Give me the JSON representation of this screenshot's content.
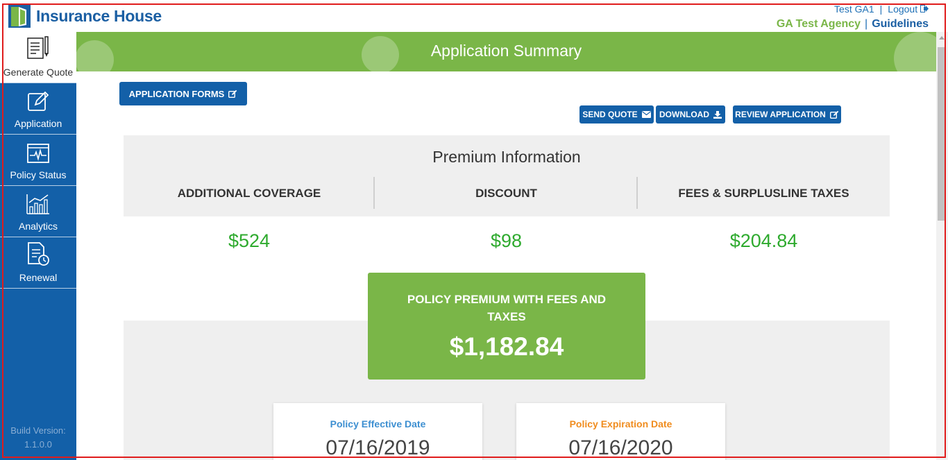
{
  "brand": {
    "name": "Insurance House"
  },
  "header": {
    "user": "Test GA1",
    "separator": "|",
    "logout_label": "Logout",
    "agency": "GA Test Agency",
    "guidelines_label": "Guidelines"
  },
  "sidebar": {
    "items": [
      {
        "label": "Generate Quote",
        "icon": "document-pencil-icon",
        "active": true
      },
      {
        "label": "Application",
        "icon": "pencil-square-icon",
        "active": false
      },
      {
        "label": "Policy Status",
        "icon": "pulse-monitor-icon",
        "active": false
      },
      {
        "label": "Analytics",
        "icon": "bar-chart-icon",
        "active": false
      },
      {
        "label": "Renewal",
        "icon": "document-clock-icon",
        "active": false
      }
    ],
    "build_label": "Build Version:",
    "build_version": "1.1.0.0"
  },
  "page": {
    "title": "Application Summary"
  },
  "actions": {
    "application_forms": "APPLICATION FORMS",
    "send_quote": "SEND QUOTE",
    "download": "DOWNLOAD",
    "review_application": "REVIEW APPLICATION"
  },
  "premium": {
    "title": "Premium Information",
    "columns": [
      {
        "label": "ADDITIONAL COVERAGE",
        "value": "$524"
      },
      {
        "label": "DISCOUNT",
        "value": "$98"
      },
      {
        "label": "FEES & SURPLUSLINE TAXES",
        "value": "$204.84"
      }
    ],
    "total_label": "POLICY PREMIUM WITH FEES AND TAXES",
    "total_value": "$1,182.84"
  },
  "dates": {
    "effective_label": "Policy Effective Date",
    "effective_value": "07/16/2019",
    "expiration_label": "Policy Expiration Date",
    "expiration_value": "07/16/2020"
  },
  "colors": {
    "brand_blue": "#1360a8",
    "brand_green": "#7ab648",
    "amount_green": "#2eaa2e",
    "effective_blue": "#3d8fd1",
    "expiration_orange": "#f08c1e"
  }
}
